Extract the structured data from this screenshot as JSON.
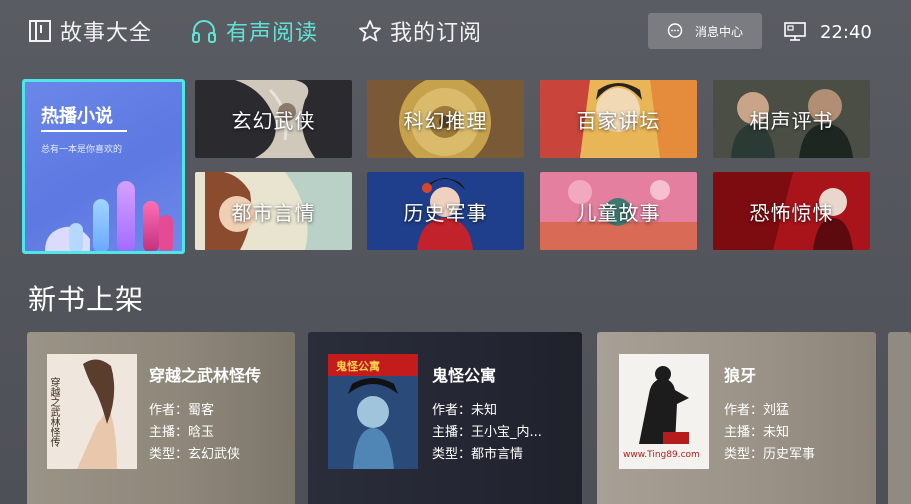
{
  "nav": {
    "tab_stories": "故事大全",
    "tab_audio": "有声阅读",
    "tab_subscriptions": "我的订阅",
    "message_center": "消息中心",
    "time": "22:40",
    "active_color": "#5fe3d6"
  },
  "featured": {
    "title": "热播小说",
    "subtitle": "总有一本是你喜欢的"
  },
  "genres": [
    {
      "label": "玄幻武侠"
    },
    {
      "label": "科幻推理"
    },
    {
      "label": "百家讲坛"
    },
    {
      "label": "相声评书"
    },
    {
      "label": "都市言情"
    },
    {
      "label": "历史军事"
    },
    {
      "label": "儿童故事"
    },
    {
      "label": "恐怖惊悚"
    }
  ],
  "section": {
    "new_books": "新书上架"
  },
  "books": [
    {
      "title": "穿越之武林怪传",
      "author": "作者：蜀客",
      "narrator": "主播：晗玉",
      "type": "类型：玄幻武侠",
      "cover_text": "穿越之武林怪传"
    },
    {
      "title": "鬼怪公寓",
      "author": "作者：未知",
      "narrator": "主播：王小宝_内...",
      "type": "类型：都市言情",
      "cover_text": "鬼怪公寓"
    },
    {
      "title": "狼牙",
      "author": "作者：刘猛",
      "narrator": "主播：未知",
      "type": "类型：历史军事",
      "cover_text": "www.Ting89.com"
    }
  ]
}
